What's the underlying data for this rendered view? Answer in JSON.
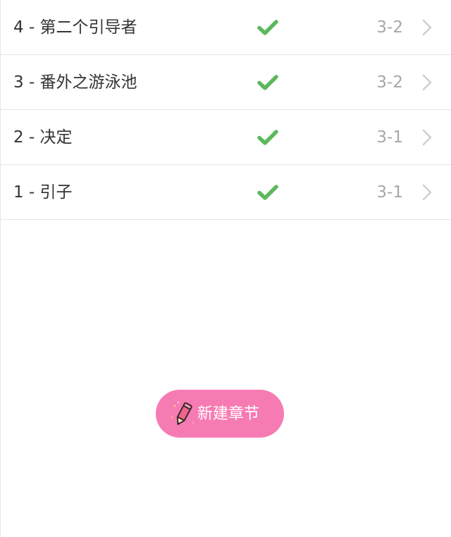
{
  "chapters": [
    {
      "title": "4 - 第二个引导者",
      "status_icon": "check-icon",
      "date": "3-2",
      "nav_icon": "chevron-right-icon"
    },
    {
      "title": "3 - 番外之游泳池",
      "status_icon": "check-icon",
      "date": "3-2",
      "nav_icon": "chevron-right-icon"
    },
    {
      "title": "2 - 决定",
      "status_icon": "check-icon",
      "date": "3-1",
      "nav_icon": "chevron-right-icon"
    },
    {
      "title": "1 - 引子",
      "status_icon": "check-icon",
      "date": "3-1",
      "nav_icon": "chevron-right-icon"
    }
  ],
  "new_chapter": {
    "label": "新建章节",
    "icon": "pencil-icon"
  },
  "colors": {
    "check": "#5cb85c",
    "chevron": "#cfcfcf",
    "title_text": "#333333",
    "date_text": "#a7a7a7",
    "divider": "#e5e5e5",
    "button_bg": "#f77bb3",
    "button_text": "#ffffff",
    "pencil_body": "#f0638f",
    "pencil_outline": "#3a2a2a"
  }
}
